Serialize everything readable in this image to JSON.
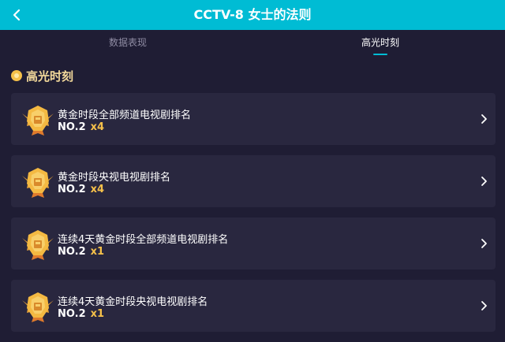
{
  "header": {
    "title": "CCTV-8 女士的法则",
    "back_icon": "chevron-left-icon",
    "background_color": "#00bcd4"
  },
  "tabs": [
    {
      "label": "数据表现",
      "active": false
    },
    {
      "label": "高光时刻",
      "active": true
    }
  ],
  "section": {
    "title": "高光时刻"
  },
  "highlights": [
    {
      "title": "黄金时段全部频道电视剧排名",
      "rank": "NO.2",
      "multiplier": "x4"
    },
    {
      "title": "黄金时段央视电视剧排名",
      "rank": "NO.2",
      "multiplier": "x4"
    },
    {
      "title": "连续4天黄金时段全部频道电视剧排名",
      "rank": "NO.2",
      "multiplier": "x1"
    },
    {
      "title": "连续4天黄金时段央视电视剧排名",
      "rank": "NO.2",
      "multiplier": "x1"
    }
  ],
  "colors": {
    "accent": "#00bcd4",
    "gold": "#f6c14a",
    "background": "#1f1d34",
    "card": "#29273f"
  }
}
